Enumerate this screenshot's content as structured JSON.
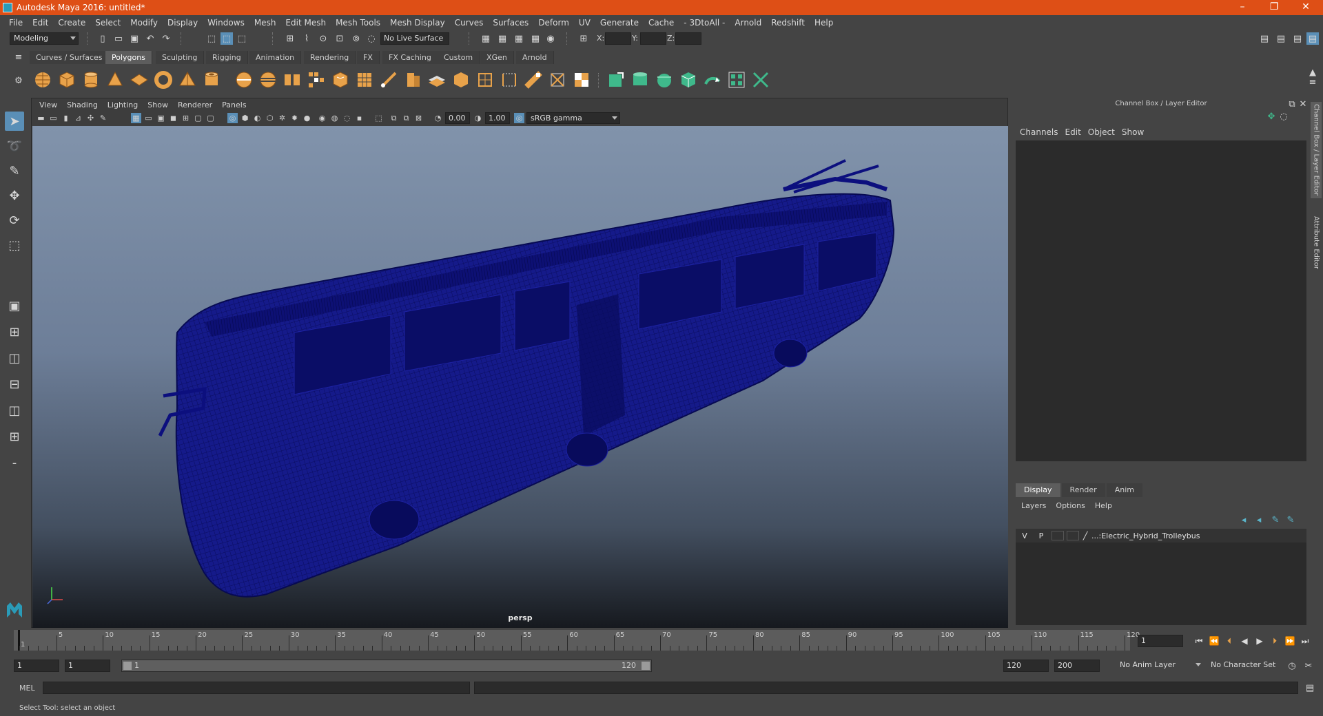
{
  "window": {
    "title": "Autodesk Maya 2016: untitled*",
    "minimize": "–",
    "maximize": "❐",
    "close": "✕"
  },
  "menubar": [
    "File",
    "Edit",
    "Create",
    "Select",
    "Modify",
    "Display",
    "Windows",
    "Mesh",
    "Edit Mesh",
    "Mesh Tools",
    "Mesh Display",
    "Curves",
    "Surfaces",
    "Deform",
    "UV",
    "Generate",
    "Cache",
    "- 3DtoAll -",
    "Arnold",
    "Redshift",
    "Help"
  ],
  "statusline": {
    "mode": "Modeling",
    "live_surface": "No Live Surface",
    "x_label": "X:",
    "y_label": "Y:",
    "z_label": "Z:"
  },
  "shelf_tabs": [
    "Curves / Surfaces",
    "Polygons",
    "Sculpting",
    "Rigging",
    "Animation",
    "Rendering",
    "FX",
    "FX Caching",
    "Custom",
    "XGen",
    "Arnold"
  ],
  "active_shelf_tab": "Polygons",
  "viewport": {
    "menus": [
      "View",
      "Shading",
      "Lighting",
      "Show",
      "Renderer",
      "Panels"
    ],
    "exposure": "0.00",
    "gamma": "1.00",
    "color_space": "sRGB gamma",
    "camera_label": "persp",
    "model_color": "#0c0f7e"
  },
  "channel_box": {
    "title": "Channel Box / Layer Editor",
    "menus": [
      "Channels",
      "Edit",
      "Object",
      "Show"
    ],
    "layer_tabs": [
      "Display",
      "Render",
      "Anim"
    ],
    "active_layer_tab": "Display",
    "layer_menus": [
      "Layers",
      "Options",
      "Help"
    ],
    "layer": {
      "visible": "V",
      "playback": "P",
      "name": "...:Electric_Hybrid_Trolleybus"
    }
  },
  "side_tabs": [
    "Channel Box / Layer Editor",
    "Attribute Editor"
  ],
  "timeline": {
    "start_marker": "1",
    "ticks": [
      5,
      10,
      15,
      20,
      25,
      30,
      35,
      40,
      45,
      50,
      55,
      60,
      65,
      70,
      75,
      80,
      85,
      90,
      95,
      100,
      105,
      110,
      115,
      120
    ],
    "current_frame": "1"
  },
  "range": {
    "start": "1",
    "anim_start": "1",
    "range_start": "1",
    "range_end": "120",
    "anim_end_1": "120",
    "anim_end_2": "200",
    "anim_layer": "No Anim Layer",
    "char_set": "No Character Set"
  },
  "command": {
    "label": "MEL"
  },
  "helpline": "Select Tool: select an object",
  "colors": {
    "titlebar": "#de4f16",
    "accent": "#5a8fb7",
    "shelf_orange": "#e8a24a",
    "shelf_green": "#3fb98b"
  }
}
